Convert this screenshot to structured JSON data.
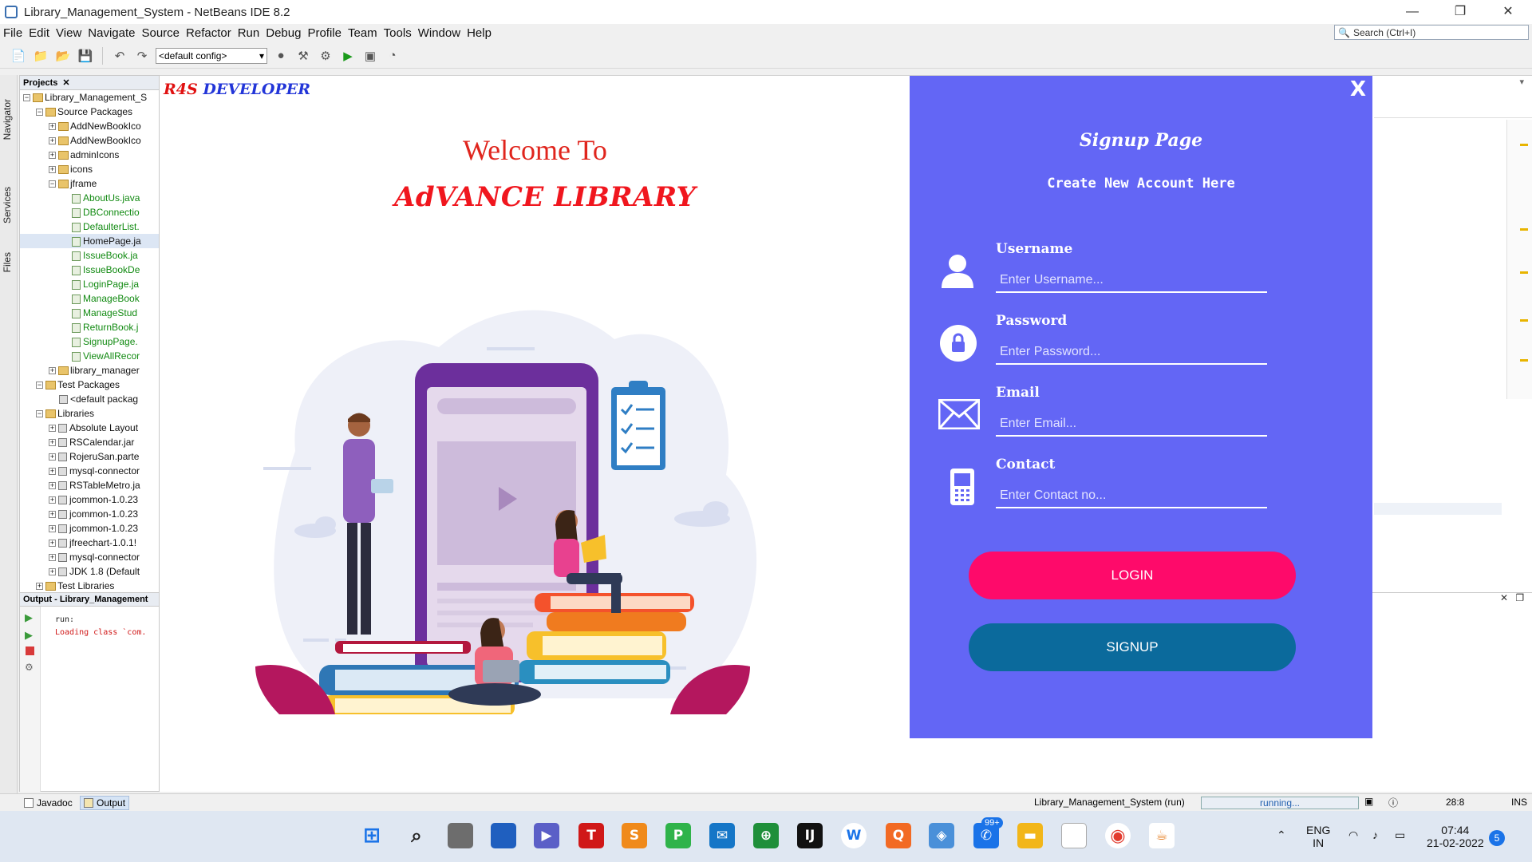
{
  "window": {
    "title": "Library_Management_System - NetBeans IDE 8.2",
    "controls": [
      "—",
      "❐",
      "✕"
    ]
  },
  "menu": [
    "File",
    "Edit",
    "View",
    "Navigate",
    "Source",
    "Refactor",
    "Run",
    "Debug",
    "Profile",
    "Team",
    "Tools",
    "Window",
    "Help"
  ],
  "search": {
    "placeholder": "Search (Ctrl+I)"
  },
  "toolbar": {
    "config": "<default config>"
  },
  "side_tabs": {
    "navigator": "Navigator",
    "services": "Services",
    "files": "Files"
  },
  "projects": {
    "tab": "Projects",
    "tree": [
      {
        "label": "Library_Management_S",
        "indent": 0,
        "kind": "project",
        "box": "-"
      },
      {
        "label": "Source Packages",
        "indent": 1,
        "kind": "folder",
        "box": "-"
      },
      {
        "label": "AddNewBookIco",
        "indent": 2,
        "kind": "folder",
        "box": "+"
      },
      {
        "label": "AddNewBookIco",
        "indent": 2,
        "kind": "folder",
        "box": "+"
      },
      {
        "label": "adminIcons",
        "indent": 2,
        "kind": "folder",
        "box": "+"
      },
      {
        "label": "icons",
        "indent": 2,
        "kind": "folder",
        "box": "+"
      },
      {
        "label": "jframe",
        "indent": 2,
        "kind": "folder",
        "box": "-"
      },
      {
        "label": "AboutUs.java",
        "indent": 3,
        "kind": "java"
      },
      {
        "label": "DBConnectio",
        "indent": 3,
        "kind": "java"
      },
      {
        "label": "DefaulterList.",
        "indent": 3,
        "kind": "java"
      },
      {
        "label": "HomePage.ja",
        "indent": 3,
        "kind": "java-sel"
      },
      {
        "label": "IssueBook.ja",
        "indent": 3,
        "kind": "java"
      },
      {
        "label": "IssueBookDe",
        "indent": 3,
        "kind": "java"
      },
      {
        "label": "LoginPage.ja",
        "indent": 3,
        "kind": "java"
      },
      {
        "label": "ManageBook",
        "indent": 3,
        "kind": "java"
      },
      {
        "label": "ManageStud",
        "indent": 3,
        "kind": "java"
      },
      {
        "label": "ReturnBook.j",
        "indent": 3,
        "kind": "java"
      },
      {
        "label": "SignupPage.",
        "indent": 3,
        "kind": "java"
      },
      {
        "label": "ViewAllRecor",
        "indent": 3,
        "kind": "java"
      },
      {
        "label": "library_manager",
        "indent": 2,
        "kind": "folder",
        "box": "+"
      },
      {
        "label": "Test Packages",
        "indent": 1,
        "kind": "folder",
        "box": "-"
      },
      {
        "label": "<default packag",
        "indent": 2,
        "kind": "lib"
      },
      {
        "label": "Libraries",
        "indent": 1,
        "kind": "folder",
        "box": "-"
      },
      {
        "label": "Absolute Layout",
        "indent": 2,
        "kind": "lib",
        "box": "+"
      },
      {
        "label": "RSCalendar.jar",
        "indent": 2,
        "kind": "lib",
        "box": "+"
      },
      {
        "label": "RojeruSan.parte",
        "indent": 2,
        "kind": "lib",
        "box": "+"
      },
      {
        "label": "mysql-connector",
        "indent": 2,
        "kind": "lib",
        "box": "+"
      },
      {
        "label": "RSTableMetro.ja",
        "indent": 2,
        "kind": "lib",
        "box": "+"
      },
      {
        "label": "jcommon-1.0.23",
        "indent": 2,
        "kind": "lib",
        "box": "+"
      },
      {
        "label": "jcommon-1.0.23",
        "indent": 2,
        "kind": "lib",
        "box": "+"
      },
      {
        "label": "jcommon-1.0.23",
        "indent": 2,
        "kind": "lib",
        "box": "+"
      },
      {
        "label": "jfreechart-1.0.1!",
        "indent": 2,
        "kind": "lib",
        "box": "+"
      },
      {
        "label": "mysql-connector",
        "indent": 2,
        "kind": "lib",
        "box": "+"
      },
      {
        "label": "JDK 1.8 (Default",
        "indent": 2,
        "kind": "lib",
        "box": "+"
      },
      {
        "label": "Test Libraries",
        "indent": 1,
        "kind": "folder",
        "box": "+"
      }
    ]
  },
  "output": {
    "tab": "Output - Library_Management",
    "lines": [
      "run:",
      "Loading class `com."
    ]
  },
  "app": {
    "brand_r4s": "R4S",
    "brand_dev": "DEVELOPER",
    "welcome": "Welcome To",
    "library": "AdVANCE LIBRARY",
    "close": "X",
    "signup_title": "Signup Page",
    "signup_subtitle": "Create New Account Here",
    "fields": [
      {
        "label": "Username",
        "placeholder": "Enter Username...",
        "icon": "user-icon"
      },
      {
        "label": "Password",
        "placeholder": "Enter Password...",
        "icon": "lock-icon"
      },
      {
        "label": "Email",
        "placeholder": "Enter Email...",
        "icon": "envelope-icon"
      },
      {
        "label": "Contact",
        "placeholder": "Enter Contact no...",
        "icon": "phone-icon"
      }
    ],
    "login": "LOGIN",
    "signup": "SIGNUP",
    "colors": {
      "panel": "#6366f5",
      "login": "#fe0a6a",
      "signup": "#0b6a9c",
      "title_red": "#e0251d"
    }
  },
  "statusbar": {
    "javadoc": "Javadoc",
    "output": "Output",
    "run_label": "Library_Management_System (run)",
    "progress": "running...",
    "position": "28:8",
    "mode": "INS"
  },
  "taskbar": {
    "badge": "99+",
    "lang1": "ENG",
    "lang2": "IN",
    "time": "07:44",
    "date": "21-02-2022",
    "notif": "5"
  }
}
